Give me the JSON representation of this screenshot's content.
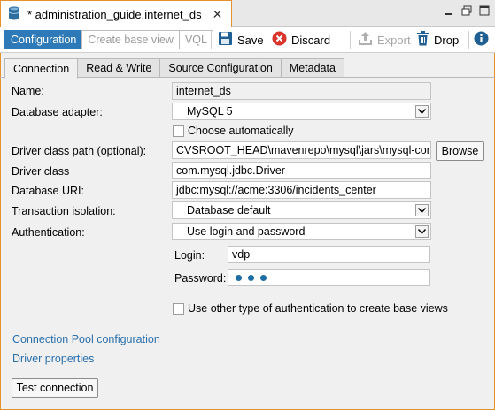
{
  "document_tab": {
    "title": "* administration_guide.internet_ds",
    "icon": "database-icon",
    "close_glyph": "✕"
  },
  "toolbar": {
    "segments": [
      "Configuration",
      "Create base view",
      "VQL"
    ],
    "active_segment": "Configuration",
    "save_label": "Save",
    "discard_label": "Discard",
    "export_label": "Export",
    "drop_label": "Drop",
    "info_icon": "info-icon"
  },
  "tabs": [
    "Connection",
    "Read & Write",
    "Source Configuration",
    "Metadata"
  ],
  "active_tab": "Connection",
  "form": {
    "name_label": "Name:",
    "name_value": "internet_ds",
    "adapter_label": "Database adapter:",
    "adapter_value": "MySQL 5",
    "choose_auto_label": "Choose automatically",
    "driver_path_label": "Driver class path (optional):",
    "driver_path_value": "CVSROOT_HEAD\\mavenrepo\\mysql\\jars\\mysql-conn",
    "browse_label": "Browse",
    "driver_class_label": "Driver class",
    "driver_class_value": "com.mysql.jdbc.Driver",
    "uri_label": "Database URI:",
    "uri_value": "jdbc:mysql://acme:3306/incidents_center",
    "isolation_label": "Transaction isolation:",
    "isolation_value": "Database default",
    "auth_label": "Authentication:",
    "auth_value": "Use login and password",
    "login_label": "Login:",
    "login_value": "vdp",
    "password_label": "Password:",
    "other_auth_label": "Use other type of authentication to create base views"
  },
  "links": {
    "pool": "Connection Pool configuration",
    "driver_props": "Driver properties"
  },
  "test_button": "Test connection",
  "colors": {
    "accent": "#2e7ab8",
    "frame": "#e6922a",
    "link": "#2a6fad",
    "discard_red": "#d9352b"
  }
}
